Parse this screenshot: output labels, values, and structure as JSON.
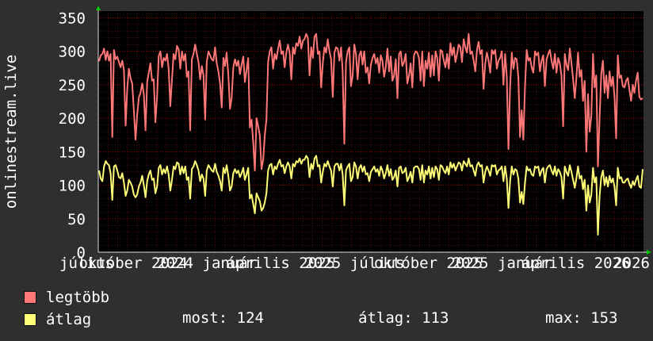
{
  "chart_data": {
    "type": "line",
    "ylabel": "onlinestream.live",
    "yticks": [
      0,
      50,
      100,
      150,
      200,
      250,
      300,
      350
    ],
    "ylim": [
      0,
      360
    ],
    "xtick_labels": [
      "július",
      "október 2024",
      "2024 január",
      "április 2025",
      "2025 július",
      "október 2025",
      "2025 január",
      "április 2026",
      "2026"
    ],
    "grid": true,
    "colors": {
      "legtobb": "#ff7777",
      "atlag": "#ffff77",
      "grid": "#b00000",
      "axis": "#dddddd"
    },
    "series": [
      {
        "name": "legtöbb",
        "color": "#ff7777",
        "values": [
          285,
          294,
          296,
          304,
          287,
          300,
          286,
          296,
          172,
          302,
          288,
          292,
          284,
          276,
          286,
          272,
          189,
          244,
          274,
          260,
          252,
          212,
          168,
          205,
          231,
          238,
          252,
          236,
          182,
          254,
          268,
          282,
          256,
          258,
          194,
          232,
          293,
          300,
          276,
          290,
          286,
          296,
          274,
          218,
          258,
          296,
          288,
          308,
          303,
          274,
          300,
          286,
          296,
          262,
          270,
          182,
          288,
          296,
          310,
          296,
          284,
          258,
          278,
          264,
          198,
          284,
          300,
          294,
          288,
          286,
          306,
          282,
          270,
          252,
          216,
          290,
          278,
          298,
          266,
          214,
          230,
          276,
          288,
          278,
          286,
          266,
          280,
          292,
          254,
          272,
          290,
          186,
          198,
          164,
          122,
          200,
          188,
          174,
          124,
          138,
          174,
          198,
          284,
          300,
          306,
          274,
          296,
          288,
          304,
          316,
          296,
          300,
          276,
          298,
          310,
          298,
          258,
          306,
          296,
          312,
          308,
          322,
          304,
          316,
          318,
          326,
          320,
          264,
          306,
          290,
          322,
          326,
          296,
          300,
          246,
          282,
          306,
          298,
          318,
          300,
          288,
          232,
          298,
          306,
          304,
          286,
          306,
          270,
          162,
          284,
          300,
          306,
          248,
          264,
          310,
          296,
          258,
          294,
          300,
          280,
          300,
          268,
          276,
          252,
          280,
          290,
          296,
          282,
          290,
          268,
          294,
          286,
          262,
          276,
          304,
          270,
          292,
          256,
          264,
          288,
          230,
          296,
          300,
          278,
          284,
          296,
          252,
          264,
          282,
          246,
          294,
          300,
          298,
          290,
          256,
          300,
          248,
          286,
          274,
          298,
          262,
          294,
          264,
          300,
          290,
          256,
          302,
          300,
          286,
          276,
          296,
          274,
          312,
          294,
          306,
          284,
          296,
          310,
          306,
          284,
          318,
          306,
          298,
          326,
          296,
          300,
          286,
          270,
          302,
          314,
          296,
          302,
          244,
          282,
          298,
          286,
          268,
          302,
          296,
          302,
          274,
          286,
          290,
          300,
          250,
          296,
          262,
          154,
          248,
          298,
          274,
          290,
          288,
          262,
          172,
          212,
          168,
          248,
          302,
          286,
          290,
          276,
          268,
          300,
          294,
          298,
          270,
          286,
          294,
          248,
          288,
          296,
          302,
          286,
          274,
          296,
          268,
          290,
          282,
          264,
          188,
          296,
          280,
          272,
          304,
          282,
          258,
          230,
          260,
          298,
          262,
          272,
          226,
          256,
          150,
          236,
          180,
          204,
          296,
          246,
          264,
          128,
          200,
          266,
          286,
          238,
          264,
          230,
          270,
          248,
          262,
          232,
          170,
          294,
          260,
          264,
          248,
          246,
          256,
          260,
          242,
          226,
          250,
          238,
          256,
          268,
          232,
          228,
          230
        ]
      },
      {
        "name": "átlag",
        "color": "#ffff77",
        "values": [
          122,
          110,
          106,
          128,
          136,
          132,
          130,
          118,
          78,
          128,
          130,
          122,
          112,
          110,
          118,
          104,
          84,
          92,
          108,
          104,
          98,
          86,
          82,
          86,
          98,
          104,
          114,
          100,
          82,
          106,
          116,
          122,
          108,
          110,
          88,
          98,
          126,
          130,
          116,
          124,
          118,
          128,
          116,
          92,
          108,
          128,
          124,
          134,
          132,
          116,
          128,
          118,
          128,
          108,
          112,
          80,
          124,
          128,
          136,
          130,
          122,
          106,
          116,
          110,
          84,
          122,
          130,
          126,
          122,
          120,
          132,
          120,
          114,
          106,
          92,
          126,
          118,
          130,
          114,
          92,
          98,
          118,
          124,
          118,
          122,
          112,
          118,
          126,
          108,
          116,
          126,
          80,
          86,
          72,
          58,
          88,
          82,
          76,
          62,
          66,
          74,
          88,
          122,
          130,
          132,
          116,
          128,
          124,
          132,
          138,
          128,
          130,
          118,
          128,
          134,
          128,
          110,
          132,
          128,
          136,
          134,
          140,
          132,
          138,
          138,
          144,
          140,
          112,
          132,
          124,
          140,
          144,
          128,
          130,
          104,
          120,
          132,
          128,
          136,
          128,
          122,
          98,
          128,
          132,
          132,
          122,
          132,
          116,
          70,
          122,
          128,
          132,
          106,
          112,
          134,
          128,
          110,
          126,
          130,
          120,
          128,
          116,
          118,
          106,
          120,
          124,
          128,
          120,
          124,
          114,
          128,
          122,
          110,
          118,
          130,
          114,
          124,
          108,
          112,
          122,
          98,
          126,
          128,
          118,
          120,
          126,
          106,
          112,
          120,
          104,
          126,
          128,
          128,
          124,
          108,
          130,
          104,
          122,
          116,
          128,
          110,
          126,
          112,
          128,
          124,
          108,
          130,
          128,
          122,
          118,
          128,
          116,
          134,
          126,
          132,
          122,
          128,
          134,
          132,
          122,
          136,
          132,
          128,
          140,
          128,
          130,
          122,
          114,
          130,
          134,
          128,
          130,
          104,
          120,
          128,
          122,
          114,
          130,
          128,
          130,
          116,
          122,
          124,
          128,
          106,
          128,
          110,
          66,
          106,
          128,
          116,
          124,
          122,
          110,
          74,
          90,
          72,
          104,
          128,
          122,
          124,
          116,
          114,
          128,
          126,
          128,
          114,
          122,
          126,
          104,
          124,
          128,
          130,
          122,
          116,
          128,
          114,
          124,
          120,
          112,
          80,
          128,
          120,
          114,
          130,
          120,
          108,
          96,
          110,
          128,
          110,
          114,
          94,
          108,
          62,
          100,
          74,
          86,
          126,
          104,
          112,
          26,
          84,
          112,
          122,
          100,
          112,
          98,
          114,
          104,
          110,
          98,
          70,
          126,
          110,
          112,
          104,
          104,
          108,
          110,
          102,
          96,
          106,
          100,
          108,
          114,
          98,
          96,
          124
        ]
      }
    ]
  },
  "legend": {
    "item1": "legtöbb",
    "item2": "átlag",
    "stats": {
      "most": "most: 124",
      "atlag": "átlag: 113",
      "max": "max: 153"
    }
  }
}
